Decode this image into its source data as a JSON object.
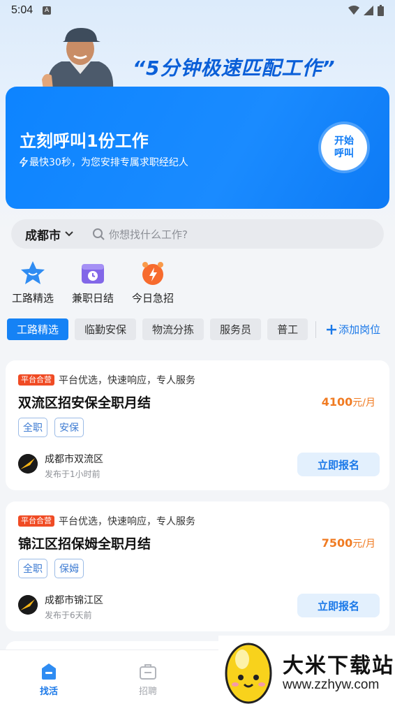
{
  "status_bar": {
    "time": "5:04",
    "notify_letter": "A"
  },
  "hero": {
    "slogan": "“5分钟极速匹配工作”"
  },
  "banner": {
    "title": "立刻呼叫1份工作",
    "subtitle": "最快30秒，为您安排专属求职经纪人",
    "call_button": "开始呼叫"
  },
  "search": {
    "city": "成都市",
    "placeholder": "你想找什么工作?"
  },
  "quick_links": [
    {
      "label": "工路精选",
      "icon": "star-badge-icon"
    },
    {
      "label": "兼职日结",
      "icon": "calendar-clock-icon"
    },
    {
      "label": "今日急招",
      "icon": "alarm-lightning-icon"
    }
  ],
  "tabs": [
    "工路精选",
    "临勤安保",
    "物流分拣",
    "服务员",
    "普工"
  ],
  "add_post": "添加岗位",
  "jobs": [
    {
      "badge": "平台合营",
      "tagline": "平台优选，快速响应，专人服务",
      "title": "双流区招安保全职月结",
      "salary": "4100",
      "salary_unit": "元/月",
      "tags": [
        "全职",
        "安保"
      ],
      "location": "成都市双流区",
      "posted": "发布于1小时前",
      "apply": "立即报名"
    },
    {
      "badge": "平台合营",
      "tagline": "平台优选，快速响应，专人服务",
      "title": "锦江区招保姆全职月结",
      "salary": "7500",
      "salary_unit": "元/月",
      "tags": [
        "全职",
        "保姆"
      ],
      "location": "成都市锦江区",
      "posted": "发布于6天前",
      "apply": "立即报名"
    }
  ],
  "bottom_nav": [
    {
      "label": "找活",
      "active": true
    },
    {
      "label": "招聘",
      "active": false
    }
  ],
  "watermark": {
    "title": "大米下载站",
    "url": "www.zzhyw.com"
  },
  "colors": {
    "primary": "#1582f5",
    "salary": "#f07b22",
    "badge": "#f04b24"
  }
}
